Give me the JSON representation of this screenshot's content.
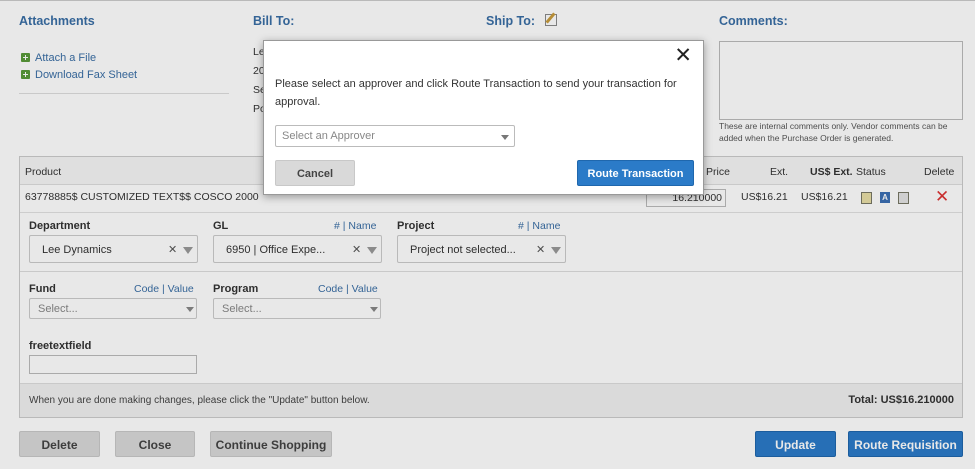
{
  "attachments": {
    "title": "Attachments",
    "attach_file": "Attach a File",
    "download_fax": "Download Fax Sheet"
  },
  "bill_to": {
    "title": "Bill To:",
    "lines": [
      "Le",
      "20",
      "Se",
      "Po"
    ]
  },
  "ship_to": {
    "title": "Ship To:",
    "edit_icon": "edit-icon"
  },
  "comments": {
    "title": "Comments:",
    "note": "These are internal comments only. Vendor comments can be added when the Purchase Order is generated."
  },
  "grid": {
    "headers": {
      "product": "Product",
      "price": "Price",
      "ext": "Ext.",
      "us_ext": "US$ Ext.",
      "status": "Status",
      "delete": "Delete"
    },
    "row": {
      "product": "63778885$ CUSTOMIZED TEXT$$ COSCO 2000",
      "price_input": "16.210000",
      "ext": "US$16.21",
      "us_ext": "US$16.21"
    },
    "department": {
      "label": "Department",
      "value": "Lee Dynamics"
    },
    "gl": {
      "label": "GL",
      "link_a": "#",
      "link_b": "Name",
      "value": "6950 | Office Expe..."
    },
    "project": {
      "label": "Project",
      "link_a": "#",
      "link_b": "Name",
      "value": "Project not selected..."
    },
    "fund": {
      "label": "Fund",
      "link_a": "Code",
      "link_b": "Value",
      "placeholder": "Select..."
    },
    "program": {
      "label": "Program",
      "link_a": "Code",
      "link_b": "Value",
      "placeholder": "Select..."
    },
    "freetext": {
      "label": "freetextfield",
      "value": ""
    },
    "footer_note": "When you are done making changes, please click the \"Update\" button below.",
    "total": "Total: US$16.210000"
  },
  "buttons": {
    "delete": "Delete",
    "close": "Close",
    "continue_shopping": "Continue Shopping",
    "update": "Update",
    "route_requisition": "Route Requisition"
  },
  "modal": {
    "message": "Please select an approver and click Route Transaction to send your transaction for approval.",
    "approver_placeholder": "Select an Approver",
    "cancel": "Cancel",
    "route_transaction": "Route Transaction",
    "close_symbol": "✕"
  },
  "colors": {
    "link": "#3a6ea5",
    "primary_button": "#2b7bc8",
    "delete_icon": "#dd3333"
  }
}
